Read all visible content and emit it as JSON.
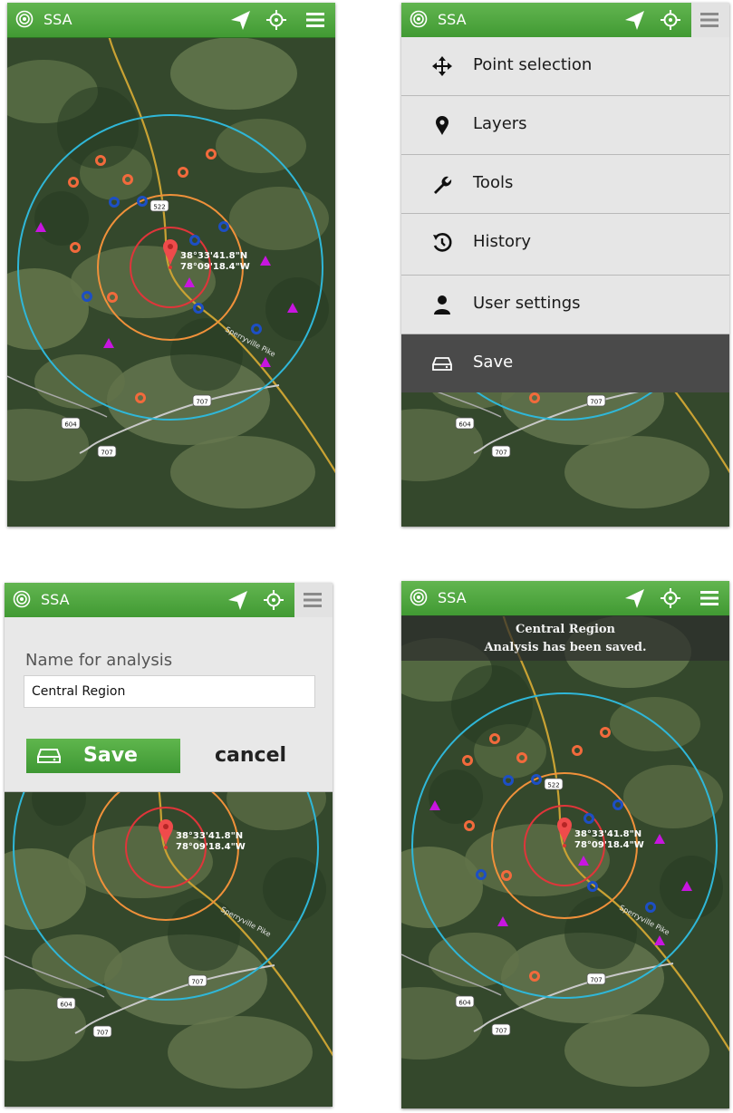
{
  "app": {
    "title": "SSA"
  },
  "marker": {
    "lat": "38°33'41.8\"N",
    "lon": "78°09'18.4\"W"
  },
  "road_labels": {
    "route_522": "522",
    "route_707": "707",
    "route_604": "604",
    "pike": "Sperryville Pike"
  },
  "menu": {
    "items": [
      {
        "label": "Point selection",
        "icon": "move-arrows-icon"
      },
      {
        "label": "Layers",
        "icon": "map-pin-icon"
      },
      {
        "label": "Tools",
        "icon": "wrench-icon"
      },
      {
        "label": "History",
        "icon": "history-icon"
      },
      {
        "label": "User settings",
        "icon": "user-icon"
      },
      {
        "label": "Save",
        "icon": "drive-icon",
        "active": true
      }
    ]
  },
  "save_dialog": {
    "label": "Name for analysis",
    "value": "Central Region",
    "save_label": "Save",
    "cancel_label": "cancel"
  },
  "toast": {
    "line1": "Central Region",
    "line2": "Analysis has been saved."
  },
  "colors": {
    "appbar": "#4aa63b",
    "ring_inner": "#e0353a",
    "ring_mid": "#f0913a",
    "ring_outer": "#2fb7d8",
    "point_orange": "#f26a3c",
    "point_blue": "#1d4fc4",
    "point_magenta": "#c815e0"
  }
}
